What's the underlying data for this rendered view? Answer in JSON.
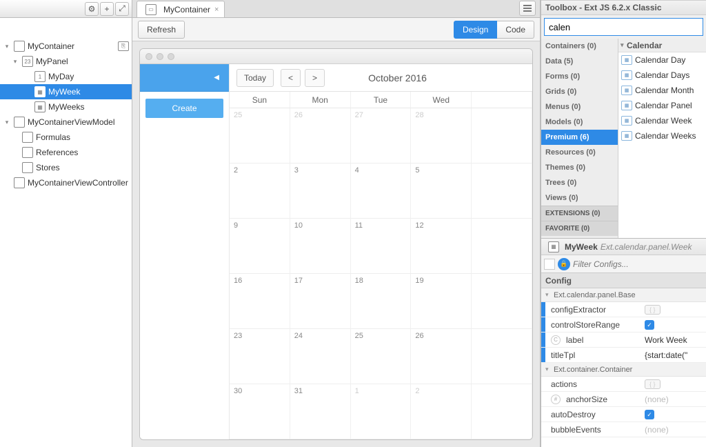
{
  "left": {
    "toolbar_icons": [
      "gear",
      "plus",
      "arrows"
    ],
    "tree": [
      {
        "label": "MyContainer",
        "icon": "container",
        "depth": 0,
        "expand": "open",
        "link": true
      },
      {
        "label": "MyPanel",
        "icon": "23",
        "depth": 1,
        "expand": "open"
      },
      {
        "label": "MyDay",
        "icon": "1",
        "depth": 2
      },
      {
        "label": "MyWeek",
        "icon": "cal",
        "depth": 2,
        "selected": true
      },
      {
        "label": "MyWeeks",
        "icon": "cal",
        "depth": 2
      },
      {
        "label": "MyContainerViewModel",
        "icon": "vm",
        "depth": 0,
        "expand": "open"
      },
      {
        "label": "Formulas",
        "icon": "fx",
        "depth": 1
      },
      {
        "label": "References",
        "icon": "ref",
        "depth": 1
      },
      {
        "label": "Stores",
        "icon": "db",
        "depth": 1
      },
      {
        "label": "MyContainerViewController",
        "icon": "vc",
        "depth": 0
      }
    ]
  },
  "center": {
    "tab_icon": "container",
    "tab_label": "MyContainer",
    "refresh": "Refresh",
    "design": "Design",
    "code": "Code",
    "calendar": {
      "today": "Today",
      "prev": "<",
      "next": ">",
      "title": "October 2016",
      "create": "Create",
      "day_headers": [
        "Sun",
        "Mon",
        "Tue",
        "Wed",
        ""
      ],
      "weeks": [
        [
          {
            "n": "25",
            "o": true
          },
          {
            "n": "26",
            "o": true
          },
          {
            "n": "27",
            "o": true
          },
          {
            "n": "28",
            "o": true
          },
          {
            "n": ""
          }
        ],
        [
          {
            "n": "2"
          },
          {
            "n": "3"
          },
          {
            "n": "4"
          },
          {
            "n": "5"
          },
          {
            "n": ""
          }
        ],
        [
          {
            "n": "9"
          },
          {
            "n": "10"
          },
          {
            "n": "11"
          },
          {
            "n": "12"
          },
          {
            "n": ""
          }
        ],
        [
          {
            "n": "16"
          },
          {
            "n": "17"
          },
          {
            "n": "18"
          },
          {
            "n": "19"
          },
          {
            "n": ""
          }
        ],
        [
          {
            "n": "23"
          },
          {
            "n": "24"
          },
          {
            "n": "25"
          },
          {
            "n": "26"
          },
          {
            "n": ""
          }
        ],
        [
          {
            "n": "30"
          },
          {
            "n": "31"
          },
          {
            "n": "1",
            "o": true
          },
          {
            "n": "2",
            "o": true
          },
          {
            "n": ""
          }
        ]
      ]
    }
  },
  "toolbox": {
    "title": "Toolbox - Ext JS 6.2.x Classic",
    "search": "calen",
    "categories": [
      {
        "label": "Containers (0)"
      },
      {
        "label": "Data (5)"
      },
      {
        "label": "Forms (0)"
      },
      {
        "label": "Grids (0)"
      },
      {
        "label": "Menus (0)"
      },
      {
        "label": "Models (0)"
      },
      {
        "label": "Premium (6)",
        "selected": true
      },
      {
        "label": "Resources (0)"
      },
      {
        "label": "Themes (0)"
      },
      {
        "label": "Trees (0)"
      },
      {
        "label": "Views (0)"
      },
      {
        "label": "EXTENSIONS (0)",
        "dark": true
      },
      {
        "label": "FAVORITE (0)",
        "dark": true
      }
    ],
    "group": "Calendar",
    "items": [
      "Calendar Day",
      "Calendar Days",
      "Calendar Month",
      "Calendar Panel",
      "Calendar Week",
      "Calendar Weeks"
    ]
  },
  "inspector": {
    "title_icon": "cal",
    "title": "MyWeek",
    "class": "Ext.calendar.panel.Week",
    "filter_placeholder": "Filter Configs...",
    "config_label": "Config",
    "groups": [
      {
        "name": "Ext.calendar.panel.Base",
        "rows": [
          {
            "name": "configExtractor",
            "val": "",
            "type": "pill",
            "mod": true
          },
          {
            "name": "controlStoreRange",
            "val": "check",
            "type": "check",
            "mod": true
          },
          {
            "name": "label",
            "val": "Work Week",
            "badge": "C",
            "mod": true
          },
          {
            "name": "titleTpl",
            "val": "{start:date(\"",
            "mod": true
          }
        ]
      },
      {
        "name": "Ext.container.Container",
        "rows": [
          {
            "name": "actions",
            "val": "",
            "type": "pill"
          },
          {
            "name": "anchorSize",
            "val": "(none)",
            "placeholder": true,
            "badge": "#"
          },
          {
            "name": "autoDestroy",
            "val": "check",
            "type": "check"
          },
          {
            "name": "bubbleEvents",
            "val": "(none)",
            "placeholder": true
          }
        ]
      }
    ]
  }
}
